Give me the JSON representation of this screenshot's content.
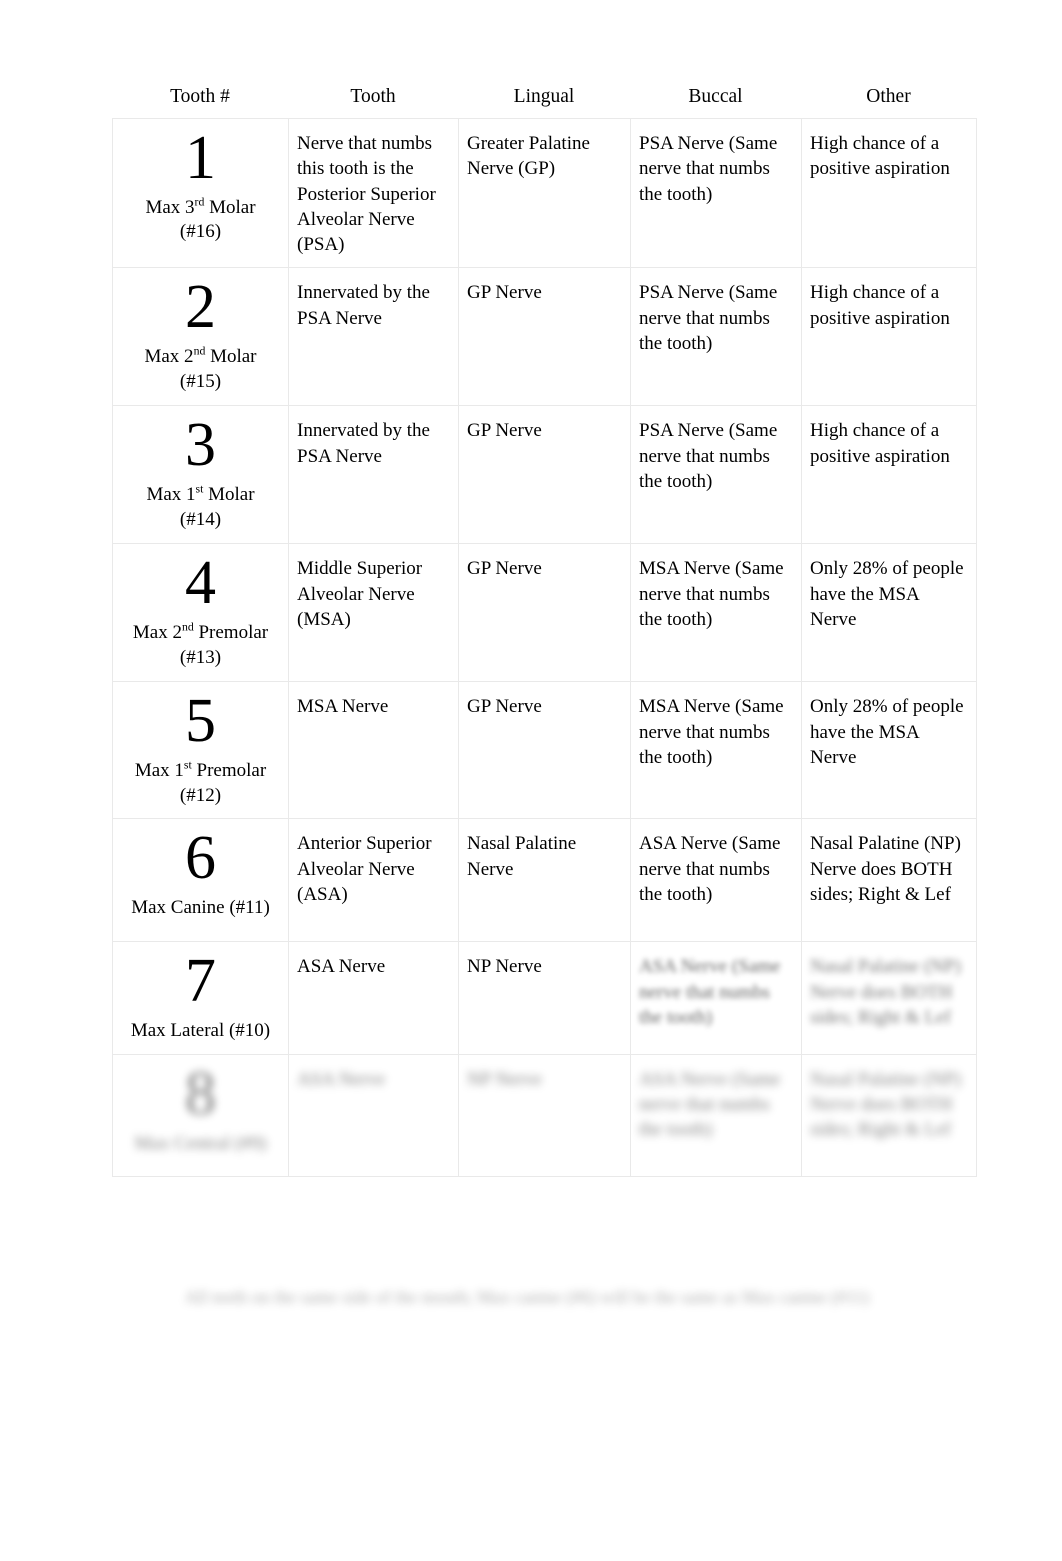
{
  "document": {
    "table_headers": [
      "Tooth #",
      "Tooth",
      "Lingual",
      "Buccal",
      "Other"
    ],
    "rows": [
      {
        "number": "1",
        "tooth_label_prefix": "Max 3",
        "tooth_label_sup": "rd",
        "tooth_label_suffix": " Molar",
        "tooth_label_code": "(#16)",
        "tooth": "Nerve that numbs this tooth is the Posterior Superior Alveolar Nerve (PSA)",
        "lingual": "Greater Palatine Nerve (GP)",
        "buccal": "PSA Nerve (Same nerve that numbs the tooth)",
        "other": "High chance of a positive aspiration",
        "clarity": "clear"
      },
      {
        "number": "2",
        "tooth_label_prefix": "Max 2",
        "tooth_label_sup": "nd",
        "tooth_label_suffix": " Molar",
        "tooth_label_code": "(#15)",
        "tooth": "Innervated by the PSA Nerve",
        "lingual": "GP Nerve",
        "buccal": "PSA Nerve (Same nerve that numbs the tooth)",
        "other": "High chance of a positive aspiration",
        "clarity": "clear"
      },
      {
        "number": "3",
        "tooth_label_prefix": "Max 1",
        "tooth_label_sup": "st",
        "tooth_label_suffix": " Molar",
        "tooth_label_code": "(#14)",
        "tooth": "Innervated by the PSA Nerve",
        "lingual": "GP Nerve",
        "buccal": "PSA Nerve (Same nerve that numbs the tooth)",
        "other": "High chance of a positive aspiration",
        "clarity": "clear"
      },
      {
        "number": "4",
        "tooth_label_prefix": "Max 2",
        "tooth_label_sup": "nd",
        "tooth_label_suffix": " Premolar",
        "tooth_label_code": "(#13)",
        "tooth": "Middle Superior Alveolar Nerve (MSA)",
        "lingual": "GP Nerve",
        "buccal": "MSA Nerve (Same nerve that numbs the tooth)",
        "other": "Only 28% of people have the MSA Nerve",
        "clarity": "clear"
      },
      {
        "number": "5",
        "tooth_label_prefix": "Max 1",
        "tooth_label_sup": "st",
        "tooth_label_suffix": " Premolar",
        "tooth_label_code": "(#12)",
        "tooth": "MSA Nerve",
        "lingual": "GP Nerve",
        "buccal": "MSA Nerve (Same nerve that numbs the tooth)",
        "other": "Only 28% of people have the MSA Nerve",
        "clarity": "clear"
      },
      {
        "number": "6",
        "tooth_label_prefix": "Max Canine (#11)",
        "tooth_label_sup": "",
        "tooth_label_suffix": "",
        "tooth_label_code": "",
        "tooth": "Anterior Superior Alveolar Nerve (ASA)",
        "lingual": "Nasal Palatine Nerve",
        "buccal": "ASA Nerve (Same nerve that numbs the tooth)",
        "other": "Nasal Palatine (NP) Nerve does BOTH sides; Right & Lef",
        "clarity": "clear"
      },
      {
        "number": "7",
        "tooth_label_prefix": "Max Lateral (#10)",
        "tooth_label_sup": "",
        "tooth_label_suffix": "",
        "tooth_label_code": "",
        "tooth": "ASA Nerve",
        "lingual": "NP Nerve",
        "buccal": "ASA Nerve (Same nerve that numbs the tooth)",
        "other": "Nasal Palatine (NP) Nerve does BOTH sides; Right & Lef",
        "clarity": "partially-blurred"
      },
      {
        "number": "8",
        "tooth_label_prefix": "Max Central (#9)",
        "tooth_label_sup": "",
        "tooth_label_suffix": "",
        "tooth_label_code": "",
        "tooth": "ASA Nerve",
        "lingual": "NP Nerve",
        "buccal": "ASA Nerve (Same nerve that numbs the tooth)",
        "other": "Nasal Palatine (NP) Nerve does BOTH sides; Right & Lef",
        "clarity": "blurred"
      }
    ],
    "footer_note": "All teeth on the same side of the mouth; Max canine (#6) will be the same as Max canine (#11)"
  }
}
